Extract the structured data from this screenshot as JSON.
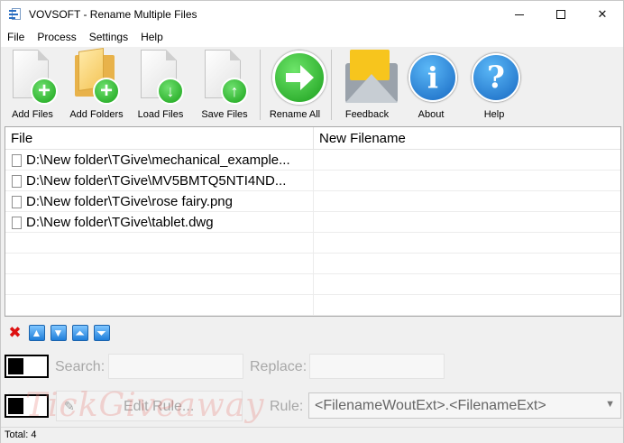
{
  "window": {
    "title": "VOVSOFT - Rename Multiple Files"
  },
  "menu": [
    "File",
    "Process",
    "Settings",
    "Help"
  ],
  "toolbar": {
    "add_files": "Add Files",
    "add_folders": "Add Folders",
    "load_files": "Load Files",
    "save_files": "Save Files",
    "rename_all": "Rename All",
    "feedback": "Feedback",
    "about": "About",
    "help": "Help"
  },
  "list": {
    "columns": [
      "File",
      "New Filename"
    ],
    "rows": [
      {
        "file": "D:\\New folder\\TGive\\mechanical_example...",
        "new_filename": ""
      },
      {
        "file": "D:\\New folder\\TGive\\MV5BMTQ5NTI4ND...",
        "new_filename": ""
      },
      {
        "file": "D:\\New folder\\TGive\\rose fairy.png",
        "new_filename": ""
      },
      {
        "file": "D:\\New folder\\TGive\\tablet.dwg",
        "new_filename": ""
      }
    ]
  },
  "controls": {
    "search_label": "Search:",
    "search_value": "",
    "replace_label": "Replace:",
    "replace_value": "",
    "edit_rule_label": "Edit Rule...",
    "rule_label": "Rule:",
    "rule_value": "<FilenameWoutExt>.<FilenameExt>"
  },
  "watermark": "TickGiveaway",
  "status": {
    "total": "Total: 4"
  },
  "colors": {
    "accent_green": "#19a319",
    "accent_blue": "#1b7fd6",
    "delete_red": "#d11111"
  }
}
